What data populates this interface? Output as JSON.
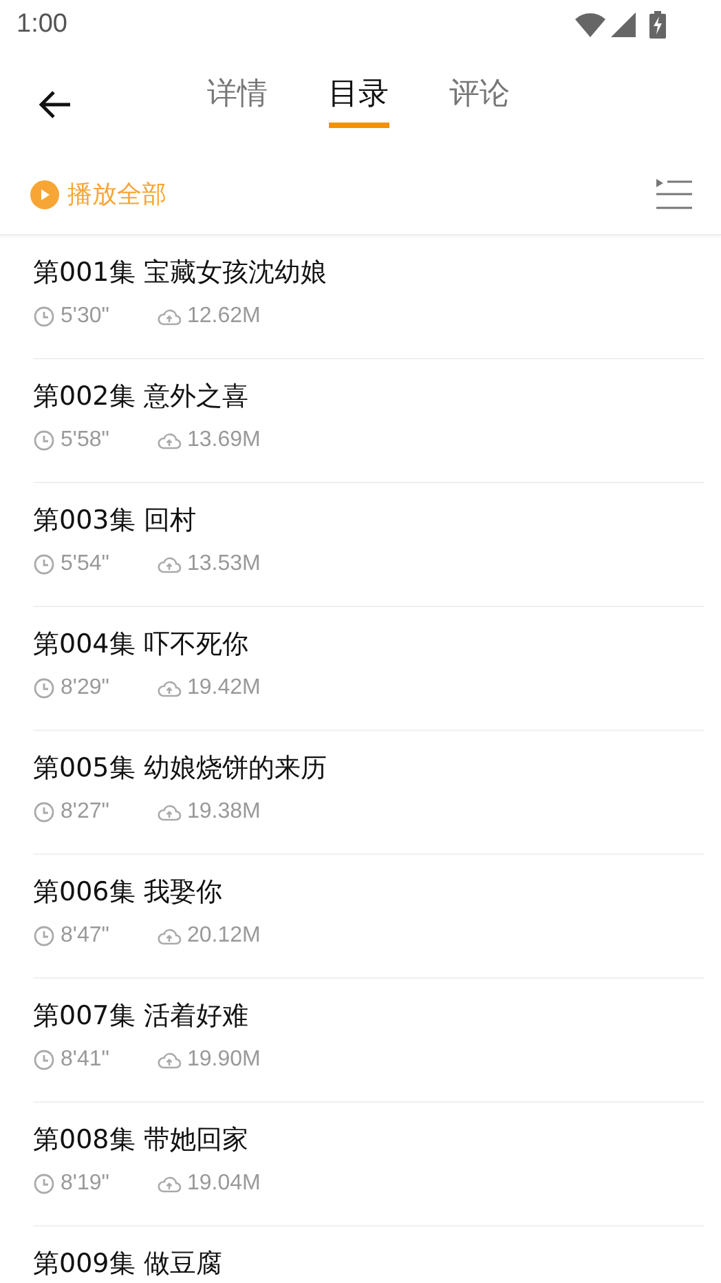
{
  "status_bar": {
    "time": "1:00"
  },
  "tabs": [
    {
      "label": "详情",
      "selected": false
    },
    {
      "label": "目录",
      "selected": true
    },
    {
      "label": "评论",
      "selected": false
    }
  ],
  "play_all": {
    "label": "播放全部"
  },
  "episodes": [
    {
      "title": "第001集 宝藏女孩沈幼娘",
      "duration": "5'30\"",
      "size": "12.62M"
    },
    {
      "title": "第002集 意外之喜",
      "duration": "5'58\"",
      "size": "13.69M"
    },
    {
      "title": "第003集 回村",
      "duration": "5'54\"",
      "size": "13.53M"
    },
    {
      "title": "第004集 吓不死你",
      "duration": "8'29\"",
      "size": "19.42M"
    },
    {
      "title": "第005集 幼娘烧饼的来历",
      "duration": "8'27\"",
      "size": "19.38M"
    },
    {
      "title": "第006集 我娶你",
      "duration": "8'47\"",
      "size": "20.12M"
    },
    {
      "title": "第007集 活着好难",
      "duration": "8'41\"",
      "size": "19.90M"
    },
    {
      "title": "第008集 带她回家",
      "duration": "8'19\"",
      "size": "19.04M"
    },
    {
      "title": "第009集 做豆腐"
    }
  ]
}
